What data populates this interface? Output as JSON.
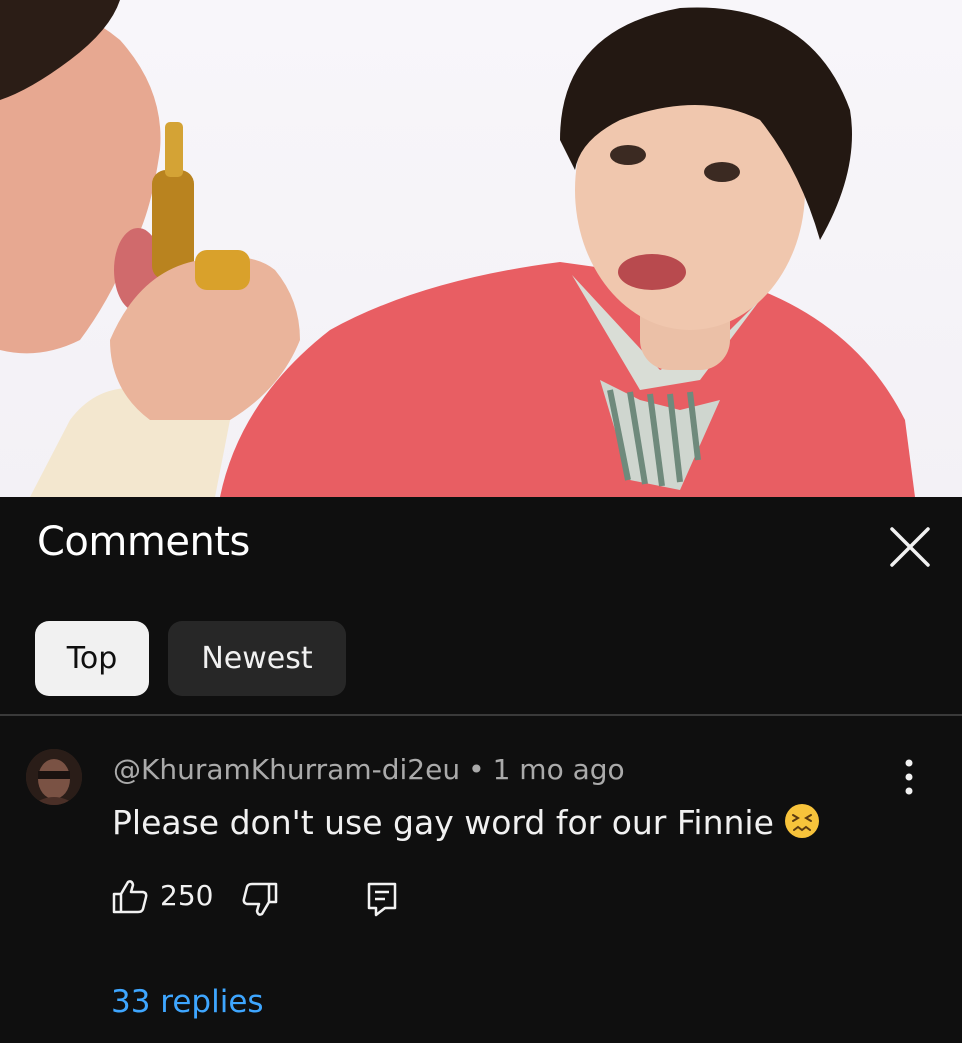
{
  "panel": {
    "title": "Comments",
    "filters": [
      {
        "label": "Top",
        "selected": true
      },
      {
        "label": "Newest",
        "selected": false
      }
    ]
  },
  "comment": {
    "author": "@KhuramKhurram-di2eu",
    "separator": "•",
    "time": "1 mo ago",
    "text": "Please don't use gay word for our Finnie",
    "emoji": "confounded-face",
    "likes": "250",
    "replies_label": "33 replies"
  },
  "icons": {
    "close": "close-icon",
    "more": "more-vert-icon",
    "like": "thumb-up-icon",
    "dislike": "thumb-down-icon",
    "reply": "reply-icon"
  },
  "colors": {
    "background": "#0f0f0f",
    "chip_selected": "#f1f1f1",
    "chip_default": "#272727",
    "link": "#3ea6ff",
    "secondary_text": "#aaaaaa"
  }
}
